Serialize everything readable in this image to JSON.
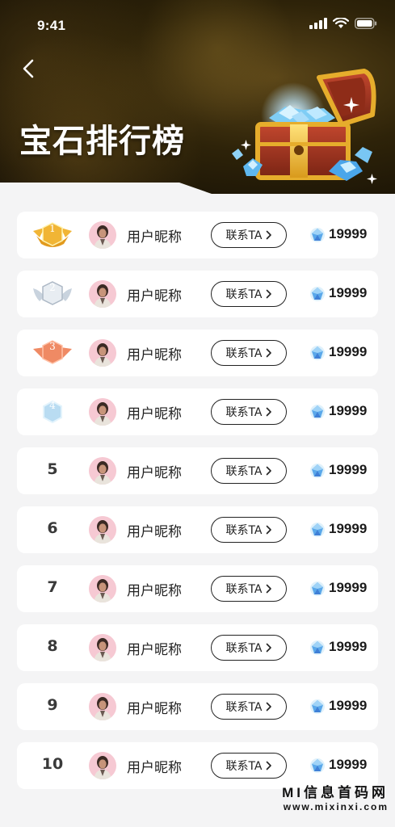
{
  "status_bar": {
    "time": "9:41"
  },
  "header": {
    "title": "宝石排行榜"
  },
  "rows": [
    {
      "rank": "1",
      "badge": "gold",
      "name": "用户昵称",
      "action": "联系TA",
      "score": "19999"
    },
    {
      "rank": "2",
      "badge": "silver",
      "name": "用户昵称",
      "action": "联系TA",
      "score": "19999"
    },
    {
      "rank": "3",
      "badge": "bronze",
      "name": "用户昵称",
      "action": "联系TA",
      "score": "19999"
    },
    {
      "rank": "4",
      "badge": "blue",
      "name": "用户昵称",
      "action": "联系TA",
      "score": "19999"
    },
    {
      "rank": "5",
      "badge": "",
      "name": "用户昵称",
      "action": "联系TA",
      "score": "19999"
    },
    {
      "rank": "6",
      "badge": "",
      "name": "用户昵称",
      "action": "联系TA",
      "score": "19999"
    },
    {
      "rank": "7",
      "badge": "",
      "name": "用户昵称",
      "action": "联系TA",
      "score": "19999"
    },
    {
      "rank": "8",
      "badge": "",
      "name": "用户昵称",
      "action": "联系TA",
      "score": "19999"
    },
    {
      "rank": "9",
      "badge": "",
      "name": "用户昵称",
      "action": "联系TA",
      "score": "19999"
    },
    {
      "rank": "10",
      "badge": "",
      "name": "用户昵称",
      "action": "联系TA",
      "score": "19999"
    }
  ],
  "watermark": {
    "title": "MI信息首码网",
    "url": "www.mixinxi.com"
  },
  "colors": {
    "gold": "#f1b535",
    "silver": "#c9d3de",
    "bronze": "#ef8a64",
    "blue": "#b9dcf2"
  }
}
